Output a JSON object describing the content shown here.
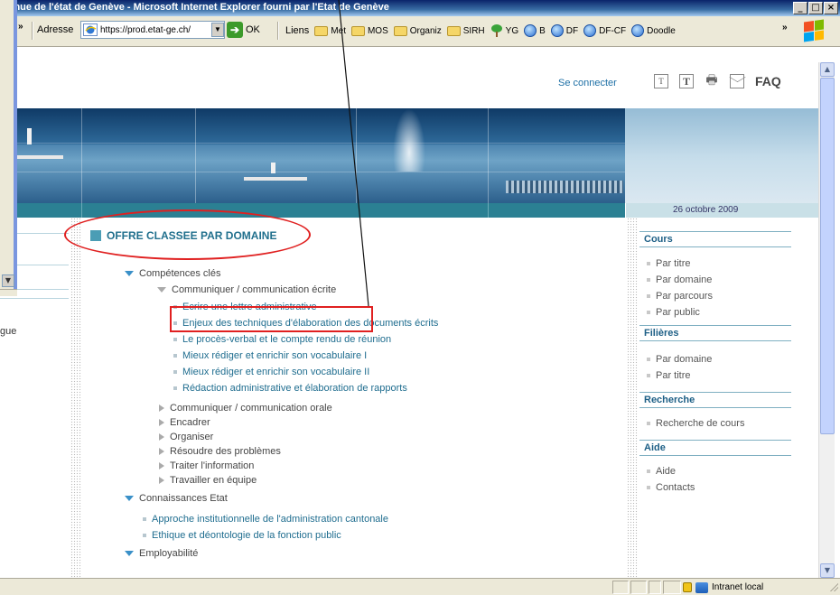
{
  "window": {
    "title": "ntinue de l'état de Genève - Microsoft Internet Explorer fourni par l'Etat de Genève",
    "buttons": [
      "_",
      "□",
      "×"
    ]
  },
  "toolbar": {
    "chevron": "»",
    "address_label": "Adresse",
    "address_value": "https://prod.etat-ge.ch/",
    "go_label": "OK",
    "links_label": "Liens",
    "links": [
      {
        "label": "Met",
        "icon": "folder-icon"
      },
      {
        "label": "MOS",
        "icon": "folder-icon"
      },
      {
        "label": "Organiz",
        "icon": "folder-icon"
      },
      {
        "label": "SIRH",
        "icon": "folder-icon"
      },
      {
        "label": "YG",
        "icon": "tree-icon"
      },
      {
        "label": "B",
        "icon": "ie-page-icon"
      },
      {
        "label": "DF",
        "icon": "ie-page-icon"
      },
      {
        "label": "DF-CF",
        "icon": "ie-page-icon"
      },
      {
        "label": "Doodle",
        "icon": "ie-page-icon"
      }
    ],
    "links_more": "»"
  },
  "page": {
    "connect_label": "Se connecter",
    "tools": {
      "small_t": "T",
      "big_t": "T",
      "print": "🖶",
      "faq": "FAQ"
    },
    "date": "26 octobre 2009",
    "left_partial_text": "gue",
    "section_title": "OFFRE CLASSEE PAR DOMAINE",
    "tree": {
      "competences": "Compétences clés",
      "communiquer_ecrite": "Communiquer / communication écrite",
      "ecrite_items": [
        "Ecrire une lettre administrative",
        "Enjeux des techniques d'élaboration des documents écrits",
        "Le procès-verbal et le compte rendu de réunion",
        "Mieux rédiger et enrichir son vocabulaire I",
        "Mieux rédiger et enrichir son vocabulaire II",
        "Rédaction administrative et élaboration de rapports"
      ],
      "collapsed": [
        "Communiquer / communication orale",
        "Encadrer",
        "Organiser",
        "Résoudre des problèmes",
        "Traiter l'information",
        "Travailler en équipe"
      ],
      "connaissances": "Connaissances Etat",
      "connaissances_items": [
        "Approche institutionnelle de l'administration cantonale",
        "Ethique et déontologie de la fonction public"
      ],
      "employabilite": "Employabilité"
    },
    "sidebar": {
      "cours_title": "Cours",
      "cours_items": [
        "Par titre",
        "Par domaine",
        "Par parcours",
        "Par public"
      ],
      "filieres_title": "Filières",
      "filieres_items": [
        "Par domaine",
        "Par titre"
      ],
      "recherche_title": "Recherche",
      "recherche_items": [
        "Recherche de cours"
      ],
      "aide_title": "Aide",
      "aide_items": [
        "Aide",
        "Contacts"
      ]
    }
  },
  "status": {
    "zone": "Intranet local"
  },
  "colors": {
    "accent": "#21708d",
    "annotation": "#e02020",
    "band": "#2b8093"
  }
}
